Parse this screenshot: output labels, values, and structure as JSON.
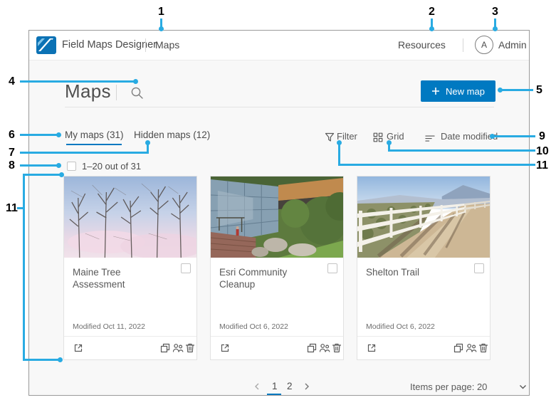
{
  "callouts": {
    "c1": "1",
    "c2": "2",
    "c3": "3",
    "c4": "4",
    "c5": "5",
    "c6": "6",
    "c7": "7",
    "c8": "8",
    "c9": "9",
    "c10": "10",
    "c11": "11"
  },
  "header": {
    "app_title": "Field Maps Designer",
    "nav_maps": "Maps",
    "resources": "Resources",
    "avatar_initial": "A",
    "username": "Admin"
  },
  "page": {
    "title": "Maps"
  },
  "actions": {
    "new_map": "New map"
  },
  "tabs": {
    "my_maps": "My maps (31)",
    "hidden_maps": "Hidden maps (12)"
  },
  "toolbar": {
    "filter": "Filter",
    "grid": "Grid",
    "sort": "Date modified"
  },
  "selection": {
    "count_label": "1–20 out of 31"
  },
  "cards": [
    {
      "title": "Maine Tree Assessment",
      "modified": "Modified Oct 11, 2022"
    },
    {
      "title": "Esri Community Cleanup",
      "modified": "Modified Oct 6, 2022"
    },
    {
      "title": "Shelton Trail",
      "modified": "Modified Oct 6, 2022"
    }
  ],
  "pagination": {
    "page1": "1",
    "page2": "2",
    "items_per_page": "Items per page: 20"
  },
  "colors": {
    "accent_blue": "#0079c1",
    "callout_blue": "#29abe2",
    "content_bg": "#f8f8f8"
  }
}
